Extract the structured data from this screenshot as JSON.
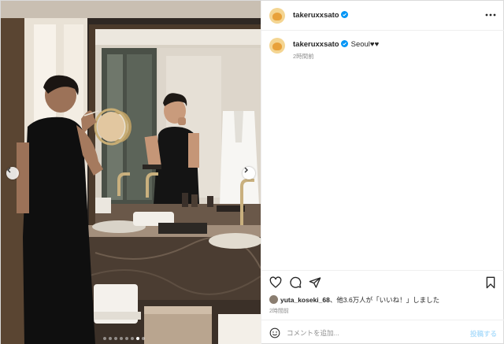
{
  "post": {
    "username": "takeruxxsato",
    "verified": true,
    "caption": {
      "username": "takeruxxsato",
      "text": "Seoul♥♥",
      "time_ago": "2時間前"
    },
    "likes_text": {
      "liker": "yuta_koseki_68",
      "rest": "、他3.6万人が「いいね！」しました"
    },
    "time_ago": "2時間前",
    "comment_placeholder": "コメントを追加...",
    "post_button": "投稿する"
  },
  "carousel": {
    "total_slides": 8,
    "active_index": 6
  },
  "colors": {
    "verified_blue": "#0095f6",
    "post_button_disabled": "#b2dffc",
    "muted_text": "#8e8e8e"
  },
  "icons": {
    "more": "more-horizontal-icon",
    "like": "heart-icon",
    "comment": "comment-icon",
    "share": "share-icon",
    "save": "bookmark-icon",
    "emoji": "emoji-icon",
    "prev": "chevron-left-icon",
    "next": "chevron-right-icon"
  }
}
